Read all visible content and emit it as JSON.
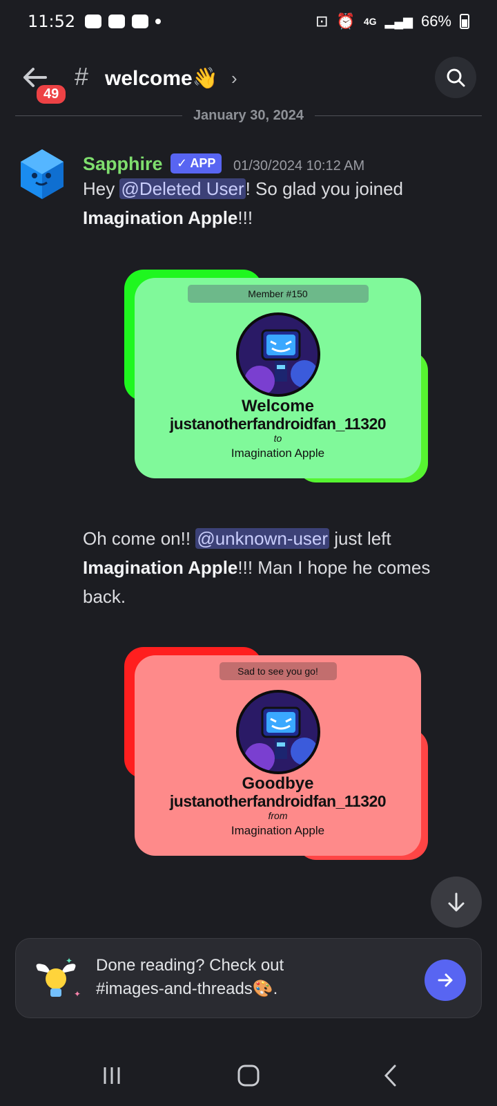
{
  "status_bar": {
    "time": "11:52",
    "network": "4G",
    "battery": "66%"
  },
  "header": {
    "unread_badge": "49",
    "channel_name": "welcome👋",
    "hash_symbol": "#"
  },
  "date_separator": "January 30, 2024",
  "message": {
    "author": "Sapphire",
    "app_tag": "✓ APP",
    "timestamp": "01/30/2024 10:12 AM",
    "text1_pre": "Hey ",
    "text1_mention": "@Deleted User",
    "text1_mid": "! So glad you joined ",
    "text1_bold": "Imagination Apple",
    "text1_post": "!!!",
    "text2_pre": "Oh come on!! ",
    "text2_mention": "@unknown-user",
    "text2_mid": " just left ",
    "text2_bold": "Imagination Apple",
    "text2_post": "!!! Man I hope he comes back."
  },
  "welcome_card": {
    "chip": "Member #150",
    "headline": "Welcome",
    "username": "justanotherfandroidfan_11320",
    "connector": "to",
    "server": "Imagination Apple",
    "bg": "#80f99a",
    "accent": "#1ff71f"
  },
  "goodbye_card": {
    "chip": "Sad to see you go!",
    "headline": "Goodbye",
    "username": "justanotherfandroidfan_11320",
    "connector": "from",
    "server": "Imagination Apple",
    "bg": "#fe8a8a",
    "accent": "#ff1f1f"
  },
  "banner": {
    "text_line1": "Done reading? Check out",
    "text_line2": "#images-and-threads🎨."
  },
  "colors": {
    "background": "#1c1d22",
    "brand": "#5865f2",
    "username": "#7fde6e"
  }
}
